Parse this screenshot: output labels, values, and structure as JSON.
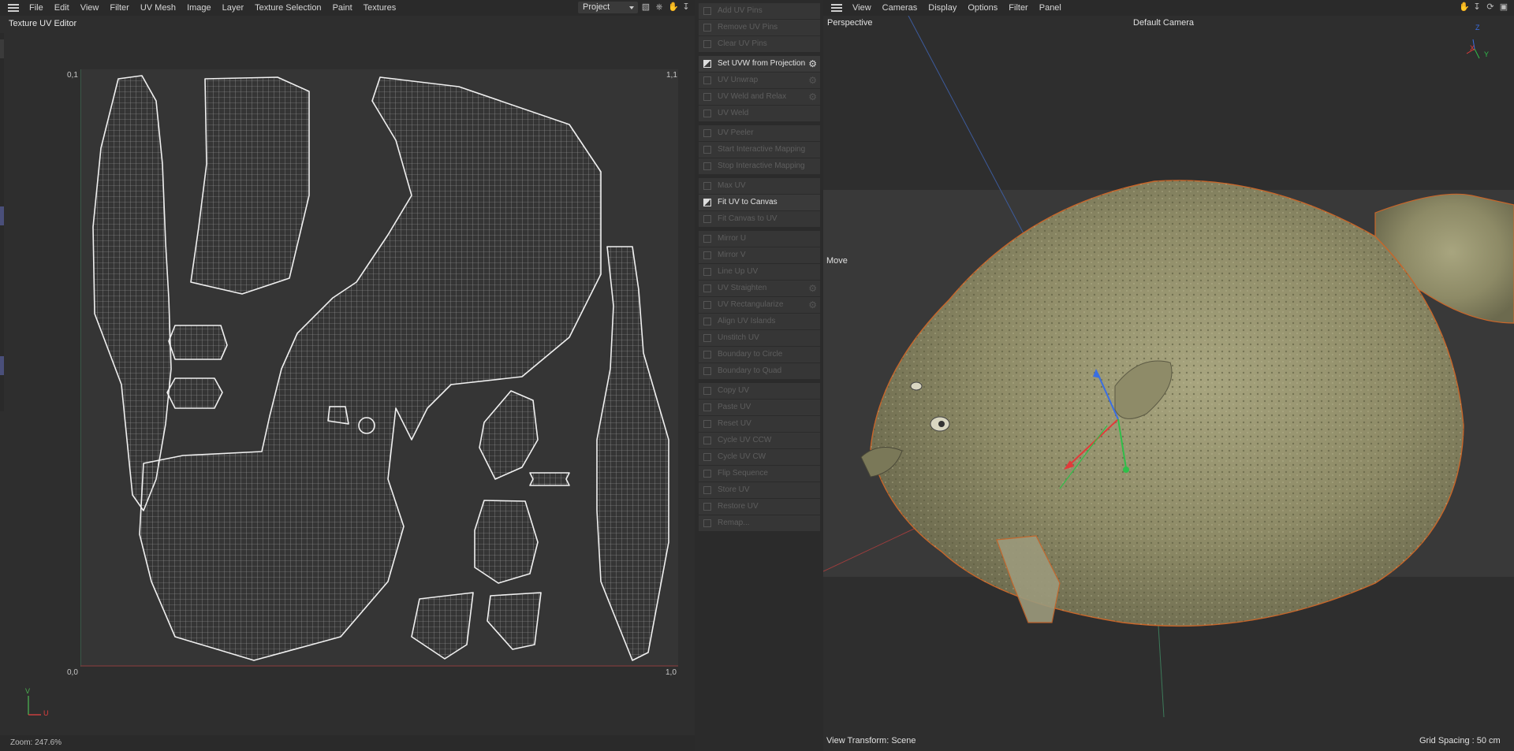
{
  "uv_editor": {
    "menu": [
      "File",
      "Edit",
      "View",
      "Filter",
      "UV Mesh",
      "Image",
      "Layer",
      "Texture Selection",
      "Paint",
      "Textures"
    ],
    "project_select": "Project",
    "panel_title": "Texture UV Editor",
    "corners": {
      "top_left": "0,1",
      "top_right": "1,1",
      "bottom_left": "0,0",
      "bottom_right": "1,0"
    },
    "axis_labels": {
      "v": "V",
      "u": "U"
    },
    "zoom": "Zoom: 247.6%",
    "toolbar_icons": [
      "bars-icon",
      "lock-icon",
      "hand-icon",
      "arrow-down-icon"
    ]
  },
  "commands": {
    "groups": [
      [
        {
          "label": "Add UV Pins",
          "enabled": false
        },
        {
          "label": "Remove UV Pins",
          "enabled": false
        },
        {
          "label": "Clear UV Pins",
          "enabled": false
        }
      ],
      [
        {
          "label": "Set UVW from Projection",
          "enabled": true,
          "gear": true
        },
        {
          "label": "UV Unwrap",
          "enabled": false,
          "gear": true
        },
        {
          "label": "UV Weld and Relax",
          "enabled": false,
          "gear": true
        },
        {
          "label": "UV Weld",
          "enabled": false
        }
      ],
      [
        {
          "label": "UV Peeler",
          "enabled": false
        },
        {
          "label": "Start Interactive Mapping",
          "enabled": false
        },
        {
          "label": "Stop Interactive Mapping",
          "enabled": false
        }
      ],
      [
        {
          "label": "Max UV",
          "enabled": false
        },
        {
          "label": "Fit UV to Canvas",
          "enabled": true
        },
        {
          "label": "Fit Canvas to UV",
          "enabled": false
        }
      ],
      [
        {
          "label": "Mirror U",
          "enabled": false
        },
        {
          "label": "Mirror V",
          "enabled": false
        },
        {
          "label": "Line Up UV",
          "enabled": false
        },
        {
          "label": "UV Straighten",
          "enabled": false,
          "gear": true
        },
        {
          "label": "UV Rectangularize",
          "enabled": false,
          "gear": true
        },
        {
          "label": "Align UV Islands",
          "enabled": false
        },
        {
          "label": "Unstitch UV",
          "enabled": false
        },
        {
          "label": "Boundary to Circle",
          "enabled": false
        },
        {
          "label": "Boundary to Quad",
          "enabled": false
        }
      ],
      [
        {
          "label": "Copy UV",
          "enabled": false
        },
        {
          "label": "Paste UV",
          "enabled": false
        },
        {
          "label": "Reset UV",
          "enabled": false
        },
        {
          "label": "Cycle UV CCW",
          "enabled": false
        },
        {
          "label": "Cycle UV CW",
          "enabled": false
        },
        {
          "label": "Flip Sequence",
          "enabled": false
        },
        {
          "label": "Store UV",
          "enabled": false
        },
        {
          "label": "Restore UV",
          "enabled": false
        },
        {
          "label": "Remap...",
          "enabled": false
        }
      ]
    ]
  },
  "viewport": {
    "menu": [
      "View",
      "Cameras",
      "Display",
      "Options",
      "Filter",
      "Panel"
    ],
    "view_name": "Perspective",
    "camera": "Default Camera",
    "tool": "Move",
    "view_transform": "View Transform: Scene",
    "grid_spacing": "Grid Spacing : 50 cm",
    "gizmo_axes": {
      "x": "X",
      "y": "Y",
      "z": "Z"
    },
    "toolbar_icons": [
      "hand-icon",
      "arrow-down-icon",
      "rotate-icon",
      "maximize-icon"
    ]
  },
  "colors": {
    "accent": "#e06a2a",
    "uv_line": "#e8e8e8",
    "fish": "#8c8a66"
  }
}
